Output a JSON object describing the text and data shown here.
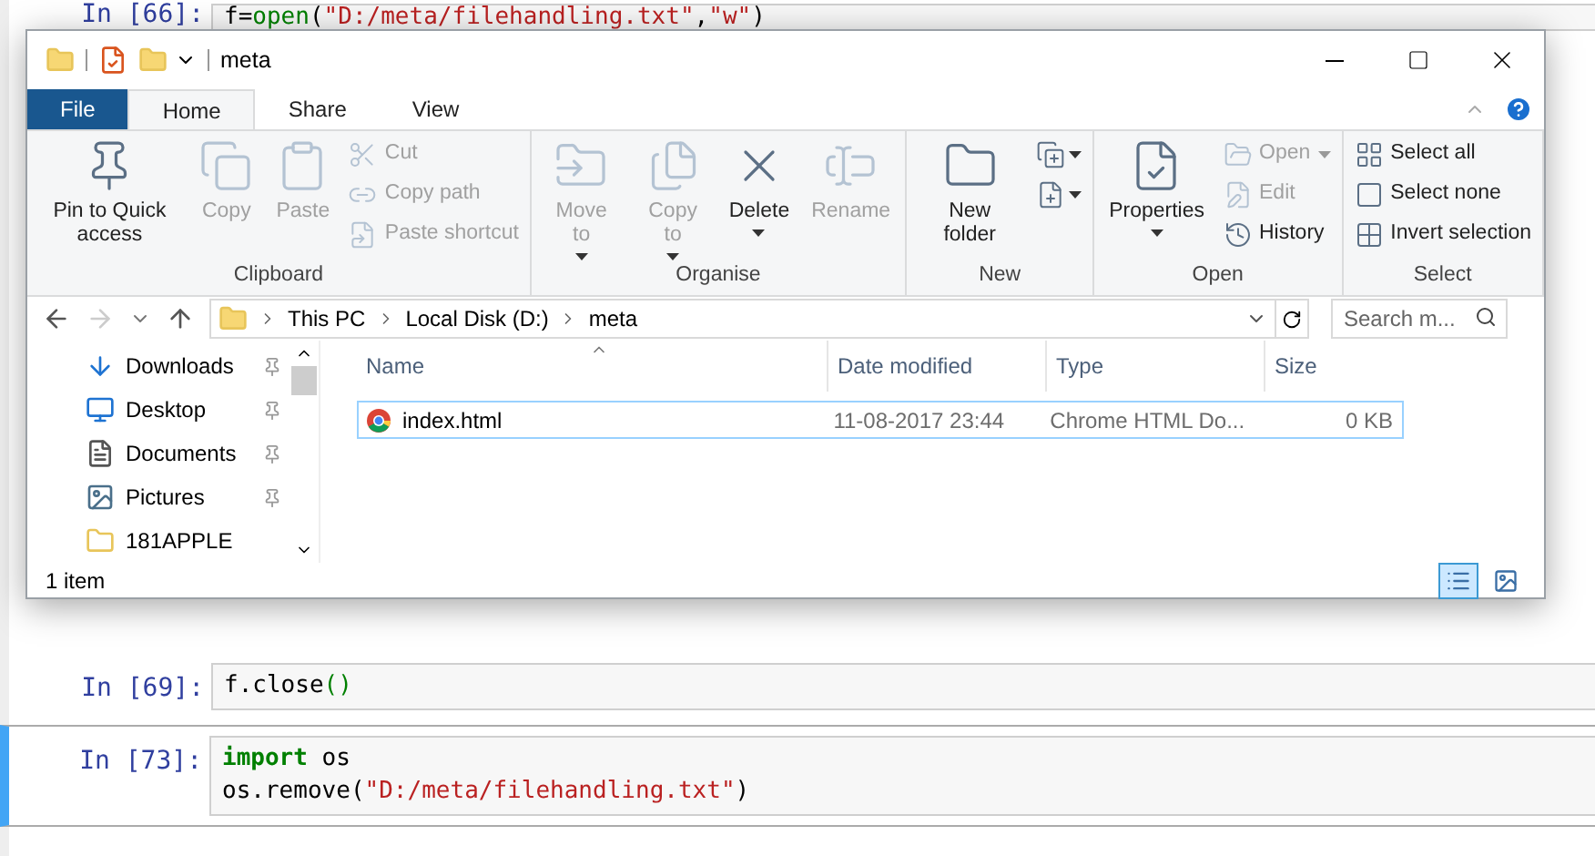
{
  "notebook": {
    "cells": [
      {
        "prompt": "In [66]:",
        "selected": false,
        "lines": [
          [
            {
              "text": "f=",
              "kind": "plain"
            },
            {
              "text": "open",
              "kind": "builtin"
            },
            {
              "text": "(",
              "kind": "plain"
            },
            {
              "text": "\"D:/meta/filehandling.txt\"",
              "kind": "string"
            },
            {
              "text": ",",
              "kind": "plain"
            },
            {
              "text": "\"w\"",
              "kind": "string"
            },
            {
              "text": ")",
              "kind": "plain"
            }
          ]
        ]
      },
      {
        "prompt": "In [69]:",
        "selected": false,
        "lines": [
          [
            {
              "text": "f.close",
              "kind": "plain"
            },
            {
              "text": "()",
              "kind": "builtin"
            }
          ]
        ]
      },
      {
        "prompt": "In [73]:",
        "selected": true,
        "lines": [
          [
            {
              "text": "import",
              "kind": "keyword"
            },
            {
              "text": " os",
              "kind": "plain"
            }
          ],
          [
            {
              "text": "os.remove(",
              "kind": "plain"
            },
            {
              "text": "\"D:/meta/filehandling.txt\"",
              "kind": "string"
            },
            {
              "text": ")",
              "kind": "plain"
            }
          ]
        ]
      }
    ]
  },
  "explorer": {
    "title": "meta",
    "tabs": [
      {
        "label": "File",
        "kind": "file",
        "selected": false
      },
      {
        "label": "Home",
        "kind": "tab",
        "selected": true
      },
      {
        "label": "Share",
        "kind": "tab",
        "selected": false
      },
      {
        "label": "View",
        "kind": "tab",
        "selected": false
      }
    ],
    "ribbon": [
      {
        "label": "Clipboard",
        "items": [
          {
            "label": "Pin to Quick access",
            "kind": "large",
            "disabled": false,
            "dropdown": false
          },
          {
            "label": "Copy",
            "kind": "large",
            "disabled": true,
            "dropdown": false
          },
          {
            "label": "Paste",
            "kind": "large",
            "disabled": true,
            "dropdown": false
          },
          {
            "label": "Cut",
            "kind": "small",
            "disabled": true,
            "dropdown": false
          },
          {
            "label": "Copy path",
            "kind": "small",
            "disabled": true,
            "dropdown": false
          },
          {
            "label": "Paste shortcut",
            "kind": "small",
            "disabled": true,
            "dropdown": false
          }
        ]
      },
      {
        "label": "Organise",
        "items": [
          {
            "label": "Move to",
            "kind": "large",
            "disabled": true,
            "dropdown": true
          },
          {
            "label": "Copy to",
            "kind": "large",
            "disabled": true,
            "dropdown": true
          },
          {
            "label": "Delete",
            "kind": "large",
            "disabled": false,
            "dropdown": true
          },
          {
            "label": "Rename",
            "kind": "large",
            "disabled": true,
            "dropdown": false
          }
        ]
      },
      {
        "label": "New",
        "items": [
          {
            "label": "New folder",
            "kind": "large",
            "disabled": false,
            "dropdown": false
          },
          {
            "kind": "icon",
            "disabled": false,
            "dropdown": true
          },
          {
            "kind": "icon",
            "disabled": false,
            "dropdown": true
          }
        ]
      },
      {
        "label": "Open",
        "items": [
          {
            "label": "Properties",
            "kind": "large",
            "disabled": false,
            "dropdown": true
          },
          {
            "label": "Open",
            "kind": "small",
            "disabled": true,
            "dropdown": true
          },
          {
            "label": "Edit",
            "kind": "small",
            "disabled": true,
            "dropdown": false
          },
          {
            "label": "History",
            "kind": "small",
            "disabled": false,
            "dropdown": false
          }
        ]
      },
      {
        "label": "Select",
        "items": [
          {
            "label": "Select all",
            "kind": "small",
            "disabled": false,
            "dropdown": false
          },
          {
            "label": "Select none",
            "kind": "small",
            "disabled": false,
            "dropdown": false
          },
          {
            "label": "Invert selection",
            "kind": "small",
            "disabled": false,
            "dropdown": false
          }
        ]
      }
    ],
    "breadcrumbs": [
      "This PC",
      "Local Disk (D:)",
      "meta"
    ],
    "search": {
      "placeholder": "Search m..."
    },
    "nav": [
      {
        "label": "Downloads",
        "pinned": true
      },
      {
        "label": "Desktop",
        "pinned": true
      },
      {
        "label": "Documents",
        "pinned": true
      },
      {
        "label": "Pictures",
        "pinned": true
      },
      {
        "label": "181APPLE",
        "pinned": false
      }
    ],
    "columns": [
      "Name",
      "Date modified",
      "Type",
      "Size"
    ],
    "rows": [
      {
        "name": "index.html",
        "date": "11-08-2017 23:44",
        "type": "Chrome HTML Do...",
        "size": "0 KB",
        "selected": true
      }
    ],
    "status_bar": "1 item",
    "views": [
      {
        "kind": "details",
        "selected": true
      },
      {
        "kind": "large_icons",
        "selected": false
      }
    ]
  }
}
